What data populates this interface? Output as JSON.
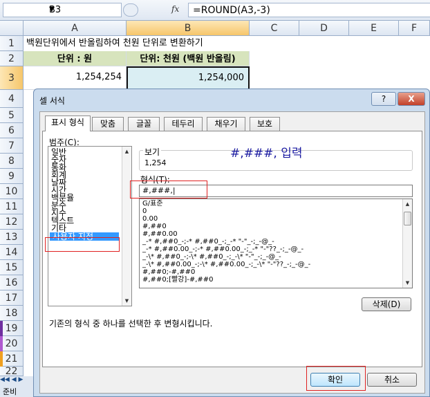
{
  "formula_bar": {
    "name_box": "B3",
    "fx_label": "fx",
    "formula": "=ROUND(A3,-3)"
  },
  "columns": [
    "A",
    "B",
    "C",
    "D",
    "E",
    "F"
  ],
  "rows": [
    "1",
    "2",
    "3",
    "4",
    "5",
    "6",
    "7",
    "8",
    "9",
    "10",
    "11",
    "12",
    "13",
    "14",
    "15",
    "16",
    "17",
    "18",
    "19",
    "20",
    "21",
    "22"
  ],
  "sheet": {
    "a1": "백원단위에서 반올림하여 천원 단위로 변환하기",
    "a2": "단위 : 원",
    "b2": "단위: 천원 (백원 반올림)",
    "a3": "1,254,254",
    "b3": "1,254,000",
    "status": "준비"
  },
  "dialog": {
    "title": "셀 서식",
    "help": "?",
    "close": "X",
    "tabs": [
      "표시 형식",
      "맞춤",
      "글꼴",
      "테두리",
      "채우기",
      "보호"
    ],
    "category_label": "범주(C):",
    "categories": [
      "일반",
      "숫자",
      "통화",
      "회계",
      "날짜",
      "시간",
      "백분율",
      "분수",
      "지수",
      "텍스트",
      "기타",
      "사용자 지정"
    ],
    "selected_category": "사용자 지정",
    "preview_label": "보기",
    "preview_value": "1,254",
    "annotation": "#,###,  입력",
    "type_label": "형식(T):",
    "type_value": "#,###,|",
    "formats": [
      "G/표준",
      "0",
      "0.00",
      "#,##0",
      "#,##0.00",
      "_-* #,##0_-;-* #,##0_-;_-* \"-\"_-;_-@_-",
      "_-* #,##0.00_-;-* #,##0.00_-;_-* \"-\"??_-;_-@_-",
      "_-\\* #,##0_-;-\\* #,##0_-;_-\\* \"-\"_-;_-@_-",
      "_-\\* #,##0.00_-;-\\* #,##0.00_-;_-\\* \"-\"??_-;_-@_-",
      "#,##0;-#,##0",
      "#,##0;[빨강]-#,##0"
    ],
    "delete_button": "삭제(D)",
    "description": "기존의 형식 중 하나를 선택한 후 변형시킵니다.",
    "ok_button": "확인",
    "cancel_button": "취소"
  },
  "colors": {
    "header_fill": "#d7e4bd",
    "selected_cell_fill": "#daeef3",
    "selection": "#3399ff",
    "annotation_box": "#e02020",
    "annotation_text": "#1a1aa0"
  }
}
